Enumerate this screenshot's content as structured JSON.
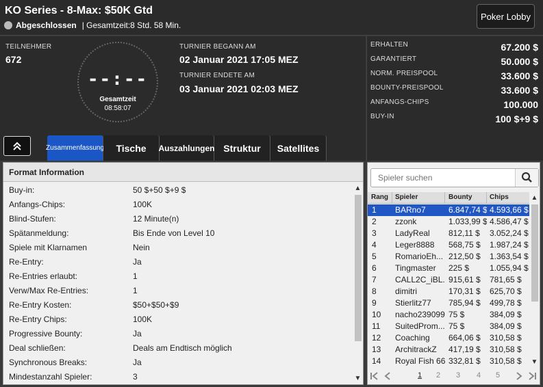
{
  "header": {
    "title": "KO Series - 8-Max: $50K Gtd",
    "status": "Abgeschlossen",
    "duration": "| Gesamtzeit:8 Std.  58 Min.",
    "lobby_button": "Poker Lobby"
  },
  "info": {
    "participants_label": "TEILNEHMER",
    "participants_value": "672",
    "clock_digits": "--:--",
    "clock_label": "Gesamtzeit",
    "clock_time": "08:58:07",
    "start_label": "TURNIER BEGANN AM",
    "start_value": "02 Januar 2021   17:05 MEZ",
    "end_label": "TURNIER ENDETE AM",
    "end_value": "03 Januar 2021   02:03 MEZ"
  },
  "prize": [
    {
      "label": "ERHALTEN",
      "value": "67.200 $"
    },
    {
      "label": "GARANTIERT",
      "value": "50.000 $"
    },
    {
      "label": "NORM. PREISPOOL",
      "value": "33.600 $"
    },
    {
      "label": "BOUNTY-PREISPOOL",
      "value": "33.600 $"
    },
    {
      "label": "ANFANGS-CHIPS",
      "value": "100.000"
    },
    {
      "label": "BUY-IN",
      "value": "100 $+9 $"
    }
  ],
  "tabs": [
    "Zusammenfassung",
    "Tische",
    "Auszahlungen",
    "Struktur",
    "Satellites"
  ],
  "format": {
    "title": "Format Information",
    "rows": [
      {
        "label": "Buy-in:",
        "value": "50 $+50 $+9 $"
      },
      {
        "label": "Anfangs-Chips:",
        "value": "100K"
      },
      {
        "label": "Blind-Stufen:",
        "value": "12 Minute(n)"
      },
      {
        "label": "Spätanmeldung:",
        "value": "Bis Ende von Level 10"
      },
      {
        "label": "Spiele mit Klarnamen",
        "value": "Nein"
      },
      {
        "label": "Re-Entry:",
        "value": "Ja"
      },
      {
        "label": "Re-Entries erlaubt:",
        "value": "1"
      },
      {
        "label": "Verw/Max Re-Entries:",
        "value": "1"
      },
      {
        "label": "Re-Entry Kosten:",
        "value": "$50+$50+$9"
      },
      {
        "label": "Re-Entry Chips:",
        "value": "100K"
      },
      {
        "label": "Progressive Bounty:",
        "value": "Ja"
      },
      {
        "label": "Deal schließen:",
        "value": "Deals am Endtisch möglich"
      },
      {
        "label": "Synchronous Breaks:",
        "value": "Ja"
      },
      {
        "label": "Mindestanzahl Spieler:",
        "value": "3"
      }
    ]
  },
  "players": {
    "search_placeholder": "Spieler suchen",
    "headers": [
      "Rang",
      "Spieler",
      "Bounty",
      "Chips"
    ],
    "rows": [
      {
        "rank": "1",
        "player": "BARno7",
        "bounty": "6.847,74 $",
        "chips": "4.593,66 $"
      },
      {
        "rank": "2",
        "player": "zzonk",
        "bounty": "1.033,99 $",
        "chips": "4.586,47 $"
      },
      {
        "rank": "3",
        "player": "LadyReal",
        "bounty": "812,11 $",
        "chips": "3.052,24 $"
      },
      {
        "rank": "4",
        "player": "Leger8888",
        "bounty": "568,75 $",
        "chips": "1.987,24 $"
      },
      {
        "rank": "5",
        "player": "RomarioEh...",
        "bounty": "212,50 $",
        "chips": "1.363,54 $"
      },
      {
        "rank": "6",
        "player": "Tingmaster",
        "bounty": "225 $",
        "chips": "1.055,94 $"
      },
      {
        "rank": "7",
        "player": "CALL2C_iBL...",
        "bounty": "915,61 $",
        "chips": "781,65 $"
      },
      {
        "rank": "8",
        "player": "dimitri",
        "bounty": "170,31 $",
        "chips": "625,70 $"
      },
      {
        "rank": "9",
        "player": "Stierlitz77",
        "bounty": "785,94 $",
        "chips": "499,78 $"
      },
      {
        "rank": "10",
        "player": "nacho239099",
        "bounty": "75 $",
        "chips": "384,09 $"
      },
      {
        "rank": "11",
        "player": "SuitedProm...",
        "bounty": "75 $",
        "chips": "384,09 $"
      },
      {
        "rank": "12",
        "player": "Coaching",
        "bounty": "664,06 $",
        "chips": "310,58 $"
      },
      {
        "rank": "13",
        "player": "ArchitrackZ",
        "bounty": "417,19 $",
        "chips": "310,58 $"
      },
      {
        "rank": "14",
        "player": "Royal Fish 66",
        "bounty": "332,81 $",
        "chips": "310,58 $"
      }
    ],
    "pages": [
      "1",
      "2",
      "3",
      "4",
      "5"
    ]
  }
}
